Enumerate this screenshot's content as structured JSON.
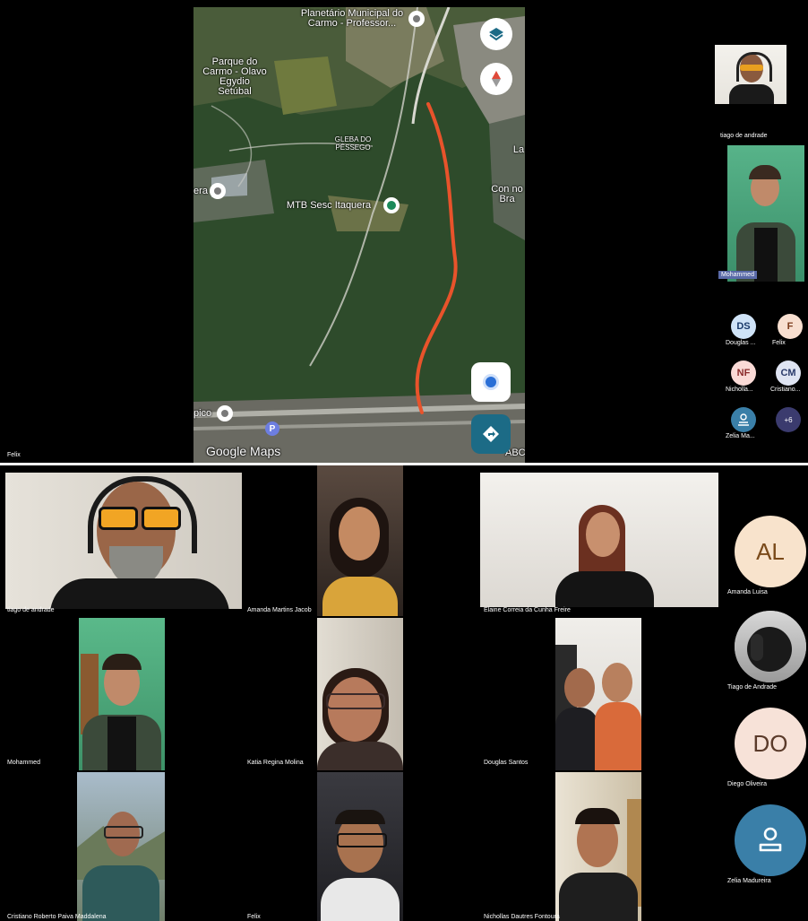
{
  "top": {
    "presenter_label": "Felix",
    "map": {
      "labels": {
        "planetario": "Planetário Municipal do Carmo - Professor...",
        "parque": "Parque do Carmo - Olavo Egydio Setúbal",
        "gleba": "GLEBA DO PÊSSEGO",
        "mtb": "MTB Sesc Itaquera",
        "con": "Con no Bra",
        "la": "La",
        "era": "era",
        "pico": "pico",
        "abc": "ABC",
        "google": "Google Maps",
        "parking": "P"
      },
      "colors": {
        "route": "#e8532b",
        "forest": "#2f4a2a",
        "pin": "#1b8a5a",
        "nav": "#1c6b86"
      }
    },
    "side": {
      "self_name": "tiago de andrade",
      "speaker_name": "Mohammed",
      "participants": [
        {
          "initials": "DS",
          "name": "Douglas ...",
          "bg": "#cfe3f7",
          "fg": "#1a3a6a"
        },
        {
          "initials": "F",
          "name": "Felix",
          "bg": "#f8dfd0",
          "fg": "#7a3a1a"
        },
        {
          "initials": "NF",
          "name": "Nicholla...",
          "bg": "#fadad6",
          "fg": "#8a2a2a"
        },
        {
          "initials": "CM",
          "name": "Cristiano...",
          "bg": "#dfe4f2",
          "fg": "#2a3a6a"
        },
        {
          "initials": "",
          "name": "Zelia Ma...",
          "bg": "#3a7fa8",
          "fg": "#ffffff"
        },
        {
          "initials": "+6",
          "name": "",
          "bg": "#3b3b6e",
          "fg": "#ffffff"
        }
      ]
    }
  },
  "grid": {
    "tiles": [
      {
        "name": "tiago de andrade"
      },
      {
        "name": "Amanda Martins Jacob"
      },
      {
        "name": "Elaine Correia da Cunha Freire"
      },
      {
        "name": "Mohammed"
      },
      {
        "name": "Katia Regina Molina"
      },
      {
        "name": "Douglas Santos"
      },
      {
        "name": "Cristiano Roberto Paiva Maddalena"
      },
      {
        "name": "Felix"
      },
      {
        "name": "Nichollas Dautres Fontoura"
      }
    ],
    "side": [
      {
        "initials": "AL",
        "name": "Amanda Luisa",
        "bg": "#f8e3cc",
        "fg": "#7a4a1a"
      },
      {
        "initials": "",
        "name": "Tiago de Andrade",
        "bg": "#c9c9c9",
        "fg": "#000"
      },
      {
        "initials": "DO",
        "name": "Diego Oliveira",
        "bg": "#f7e2d8",
        "fg": "#5a3a2a"
      },
      {
        "initials": "",
        "name": "Zelia Madureira",
        "bg": "#3a7fa8",
        "fg": "#ffffff"
      }
    ]
  }
}
